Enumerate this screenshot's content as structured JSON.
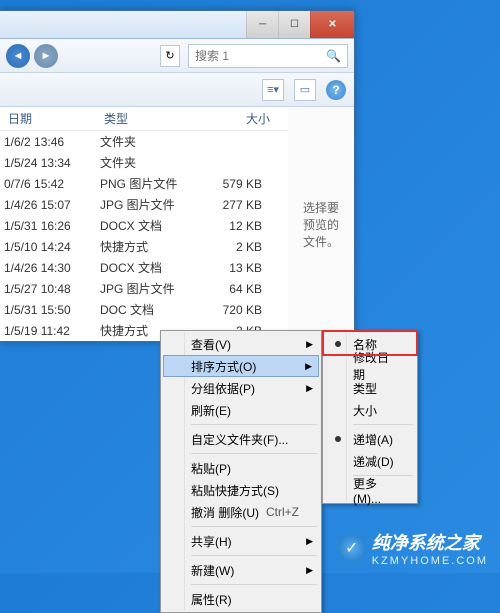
{
  "window": {
    "search_placeholder": "搜索 1"
  },
  "columns": {
    "date": "日期",
    "type": "类型",
    "size": "大小"
  },
  "files": [
    {
      "date": "1/6/2 13:46",
      "type": "文件夹",
      "size": ""
    },
    {
      "date": "1/5/24 13:34",
      "type": "文件夹",
      "size": ""
    },
    {
      "date": "0/7/6 15:42",
      "type": "PNG 图片文件",
      "size": "579 KB"
    },
    {
      "date": "1/4/26 15:07",
      "type": "JPG 图片文件",
      "size": "277 KB"
    },
    {
      "date": "1/5/31 16:26",
      "type": "DOCX 文档",
      "size": "12 KB"
    },
    {
      "date": "1/5/10 14:24",
      "type": "快捷方式",
      "size": "2 KB"
    },
    {
      "date": "1/4/26 14:30",
      "type": "DOCX 文档",
      "size": "13 KB"
    },
    {
      "date": "1/5/27 10:48",
      "type": "JPG 图片文件",
      "size": "64 KB"
    },
    {
      "date": "1/5/31 15:50",
      "type": "DOC 文档",
      "size": "720 KB"
    },
    {
      "date": "1/5/19 11:42",
      "type": "快捷方式",
      "size": "2 KB"
    }
  ],
  "preview": {
    "message": "选择要预览的文件。"
  },
  "menu_main": {
    "view": "查看(V)",
    "sort": "排序方式(O)",
    "group": "分组依据(P)",
    "refresh": "刷新(E)",
    "custom": "自定义文件夹(F)...",
    "paste": "粘贴(P)",
    "paste_shortcut": "粘贴快捷方式(S)",
    "undo": "撤消 删除(U)",
    "undo_key": "Ctrl+Z",
    "share": "共享(H)",
    "new": "新建(W)",
    "properties": "属性(R)"
  },
  "menu_sort": {
    "name": "名称",
    "date": "修改日期",
    "type": "类型",
    "size": "大小",
    "asc": "递增(A)",
    "desc": "递减(D)",
    "more": "更多(M)..."
  },
  "watermark": {
    "text": "纯净系统之家",
    "sub": "KZMYHOME.COM"
  }
}
